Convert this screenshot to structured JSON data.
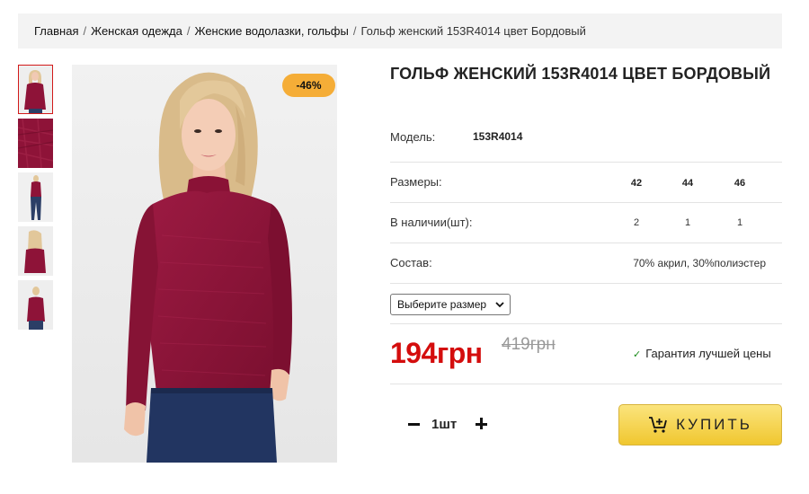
{
  "breadcrumb": {
    "home": "Главная",
    "category": "Женская одежда",
    "subcategory": "Женские водолазки, гольфы",
    "current": "Гольф женский 153R4014 цвет Бордовый",
    "separator": "/"
  },
  "gallery": {
    "thumbnails": [
      "thumb-front",
      "thumb-fabric",
      "thumb-full-length",
      "thumb-back",
      "thumb-side"
    ],
    "active_index": 0,
    "discount_badge": "-46%"
  },
  "product": {
    "title": "ГОЛЬФ ЖЕНСКИЙ 153R4014 ЦВЕТ БОРДОВЫЙ",
    "model_label": "Модель:",
    "model_value": "153R4014",
    "sizes_label": "Размеры:",
    "sizes": [
      "42",
      "44",
      "46"
    ],
    "stock_label": "В наличии(шт):",
    "stock": [
      "2",
      "1",
      "1"
    ],
    "composition_label": "Состав:",
    "composition_value": "70% акрил, 30%полиэстер",
    "size_select_placeholder": "Выберите размер"
  },
  "price": {
    "current": "194грн",
    "old": "419грн",
    "guarantee_check": "✓",
    "guarantee": "Гарантия лучшей цены"
  },
  "purchase": {
    "quantity": "1шт",
    "buy_label": "КУПИТЬ"
  },
  "colors": {
    "price_red": "#d40d0d",
    "badge_orange": "#f5ad37",
    "buy_yellow": "#f0c72f",
    "garment_burgundy": "#8e1338"
  }
}
